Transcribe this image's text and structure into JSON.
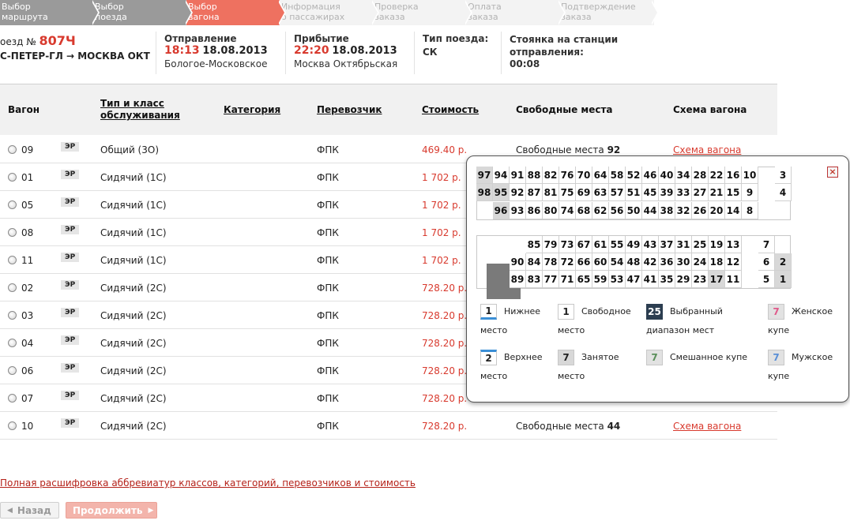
{
  "steps": [
    {
      "label": "Выбор\nмаршрута",
      "state": "done"
    },
    {
      "label": "Выбор\nпоезда",
      "state": "done"
    },
    {
      "label": "Выбор\nвагона",
      "state": "active"
    },
    {
      "label": "Информация\nо пассажирах",
      "state": "todo"
    },
    {
      "label": "Проверка\nзаказа",
      "state": "todo"
    },
    {
      "label": "Оплата\nзаказа",
      "state": "todo"
    },
    {
      "label": "Подтверждение\nзаказа",
      "state": "todo"
    }
  ],
  "train": {
    "number_label": "оезд №",
    "number": "807Ч",
    "route": "С-ПЕТЕР-ГЛ → МОСКВА ОКТ"
  },
  "departure": {
    "label": "Отправление",
    "time": "18:13",
    "date": "18.08.2013",
    "station": "Бологое-Московское"
  },
  "arrival": {
    "label": "Прибытие",
    "time": "22:20",
    "date": "18.08.2013",
    "station": "Москва Октябрьская"
  },
  "train_type": {
    "label": "Тип поезда:",
    "value": "СК"
  },
  "stop": {
    "label": "Стоянка на станции\nотправления:",
    "value": "00:08"
  },
  "table": {
    "headers": {
      "wagon": "Вагон",
      "type": "Тип и класс\nобслуживания",
      "category": "Категория",
      "carrier": "Перевозчик",
      "price": "Стоимость",
      "free": "Свободные места",
      "scheme": "Схема вагона"
    },
    "rows": [
      {
        "wagon": "09",
        "badge": "ЭР",
        "type": "Общий (3О)",
        "carrier": "ФПК",
        "price": "469.40 р.",
        "free_label": "Свободные места",
        "free": "92",
        "scheme": "Схема вагона"
      },
      {
        "wagon": "01",
        "badge": "ЭР",
        "type": "Сидячий (1С)",
        "carrier": "ФПК",
        "price": "1 702 р."
      },
      {
        "wagon": "05",
        "badge": "ЭР",
        "type": "Сидячий (1С)",
        "carrier": "ФПК",
        "price": "1 702 р."
      },
      {
        "wagon": "08",
        "badge": "ЭР",
        "type": "Сидячий (1С)",
        "carrier": "ФПК",
        "price": "1 702 р."
      },
      {
        "wagon": "11",
        "badge": "ЭР",
        "type": "Сидячий (1С)",
        "carrier": "ФПК",
        "price": "1 702 р."
      },
      {
        "wagon": "02",
        "badge": "ЭР",
        "type": "Сидячий (2С)",
        "carrier": "ФПК",
        "price": "728.20 р."
      },
      {
        "wagon": "03",
        "badge": "ЭР",
        "type": "Сидячий (2С)",
        "carrier": "ФПК",
        "price": "728.20 р."
      },
      {
        "wagon": "04",
        "badge": "ЭР",
        "type": "Сидячий (2С)",
        "carrier": "ФПК",
        "price": "728.20 р."
      },
      {
        "wagon": "06",
        "badge": "ЭР",
        "type": "Сидячий (2С)",
        "carrier": "ФПК",
        "price": "728.20 р."
      },
      {
        "wagon": "07",
        "badge": "ЭР",
        "type": "Сидячий (2С)",
        "carrier": "ФПК",
        "price": "728.20 р."
      },
      {
        "wagon": "10",
        "badge": "ЭР",
        "type": "Сидячий (2С)",
        "carrier": "ФПК",
        "price": "728.20 р.",
        "free_label": "Свободные места",
        "free": "44",
        "scheme": "Схема вагона"
      }
    ]
  },
  "legend_link": "Полная расшифровка аббревиатур классов, категорий, перевозчиков и стоимость",
  "buttons": {
    "back": "Назад",
    "next": "Продолжить"
  },
  "popup": {
    "close_icon": "close-icon",
    "seat_rows": [
      {
        "seats": [
          "97",
          "94",
          "91",
          "88",
          "82",
          "76",
          "70",
          "64",
          "58",
          "52",
          "46",
          "40",
          "34",
          "28",
          "22",
          "16",
          "10",
          "",
          "3"
        ],
        "occupied": [
          "97"
        ]
      },
      {
        "seats": [
          "98",
          "95",
          "92",
          "87",
          "81",
          "75",
          "69",
          "63",
          "57",
          "51",
          "45",
          "39",
          "33",
          "27",
          "21",
          "15",
          "9",
          "",
          "4"
        ],
        "occupied": [
          "98",
          "95"
        ]
      },
      {
        "seats": [
          "",
          "96",
          "93",
          "86",
          "80",
          "74",
          "68",
          "62",
          "56",
          "50",
          "44",
          "38",
          "32",
          "26",
          "20",
          "14",
          "8"
        ],
        "occupied": [
          "96"
        ]
      },
      {
        "seats": [
          "",
          "",
          "",
          "85",
          "79",
          "73",
          "67",
          "61",
          "55",
          "49",
          "43",
          "37",
          "31",
          "25",
          "19",
          "13",
          "",
          "7"
        ],
        "occupied": []
      },
      {
        "seats": [
          "",
          "",
          "90",
          "84",
          "78",
          "72",
          "66",
          "60",
          "54",
          "48",
          "42",
          "36",
          "30",
          "24",
          "18",
          "12",
          "",
          "6",
          "2"
        ],
        "occupied": [
          "2"
        ]
      },
      {
        "seats": [
          "",
          "",
          "89",
          "83",
          "77",
          "71",
          "65",
          "59",
          "53",
          "47",
          "41",
          "35",
          "29",
          "23",
          "17",
          "11",
          "",
          "5",
          "1"
        ],
        "occupied": [
          "17",
          "1"
        ]
      }
    ],
    "legend": [
      {
        "num": "1",
        "text1": "Нижнее",
        "text2": "место",
        "style": "lower"
      },
      {
        "num": "1",
        "text1": "Свободное",
        "text2": "место",
        "style": "free"
      },
      {
        "num": "25",
        "text1": "Выбранный",
        "text2": "диапазон мест",
        "style": "selected"
      },
      {
        "num": "7",
        "text1": "Женское",
        "text2": "купе",
        "style": "female"
      },
      {
        "num": "2",
        "text1": "Верхнее",
        "text2": "место",
        "style": "upper"
      },
      {
        "num": "7",
        "text1": "Занятое",
        "text2": "место",
        "style": "occupied"
      },
      {
        "num": "7",
        "text1": "Смешанное купе",
        "text2": "",
        "style": "mixed"
      },
      {
        "num": "7",
        "text1": "Мужское",
        "text2": "купе",
        "style": "male"
      }
    ]
  },
  "colors": {
    "accent": "#d83a2e",
    "step_active": "#ee7160",
    "step_done": "#9a9a9a",
    "selected": "#2c3e50"
  }
}
